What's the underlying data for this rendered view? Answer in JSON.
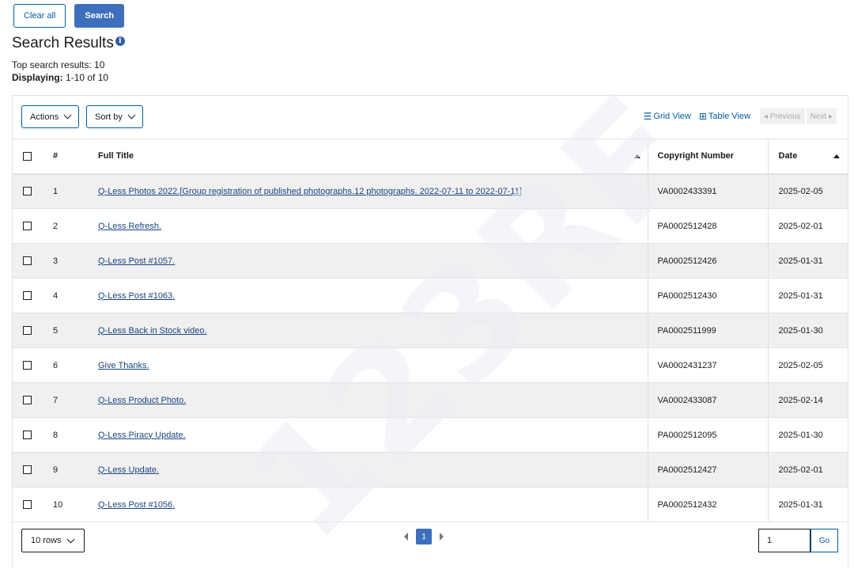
{
  "top_buttons": {
    "clear_all": "Clear all",
    "search": "Search"
  },
  "heading": {
    "title": "Search Results",
    "info_icon": "i"
  },
  "meta": {
    "top_results": "Top search results: 10",
    "displaying_label": "Displaying:",
    "displaying_value": " 1-10 of 10"
  },
  "toolbar": {
    "actions": "Actions",
    "sort_by": "Sort by",
    "grid_view": "Grid View",
    "table_view": "Table View",
    "previous": "◂ Previous",
    "next": "Next ▸"
  },
  "table": {
    "headers": {
      "num": "#",
      "title": "Full Title",
      "copyright": "Copyright Number",
      "date": "Date"
    },
    "rows": [
      {
        "num": "1",
        "title": "Q-Less Photos 2022.[Group registration of published photographs.12 photographs. 2022-07-11 to 2022-07-11]",
        "copyright": "VA0002433391",
        "date": "2025-02-05"
      },
      {
        "num": "2",
        "title": "Q-Less Refresh.",
        "copyright": "PA0002512428",
        "date": "2025-02-01"
      },
      {
        "num": "3",
        "title": "Q-Less Post #1057.",
        "copyright": "PA0002512426",
        "date": "2025-01-31"
      },
      {
        "num": "4",
        "title": "Q-Less Post #1063.",
        "copyright": "PA0002512430",
        "date": "2025-01-31"
      },
      {
        "num": "5",
        "title": "Q-Less Back in Stock video.",
        "copyright": "PA0002511999",
        "date": "2025-01-30"
      },
      {
        "num": "6",
        "title": "Give Thanks.",
        "copyright": "VA0002431237",
        "date": "2025-02-05"
      },
      {
        "num": "7",
        "title": "Q-Less Product Photo.",
        "copyright": "VA0002433087",
        "date": "2025-02-14"
      },
      {
        "num": "8",
        "title": "Q-Less Piracy Update.",
        "copyright": "PA0002512095",
        "date": "2025-01-30"
      },
      {
        "num": "9",
        "title": "Q-Less Update.",
        "copyright": "PA0002512427",
        "date": "2025-02-01"
      },
      {
        "num": "10",
        "title": "Q-Less Post #1056.",
        "copyright": "PA0002512432",
        "date": "2025-01-31"
      }
    ]
  },
  "footer": {
    "rows_select": "10 rows",
    "current_page": "1",
    "goto_value": "1",
    "go": "Go"
  },
  "watermark": "123RF",
  "colors": {
    "primary": "#3d6fbd",
    "link": "#1a4480",
    "border": "#005ea2",
    "stripe": "#f0f0f0"
  }
}
